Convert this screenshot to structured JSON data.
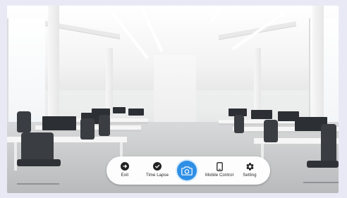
{
  "toolbar": {
    "exit_label": "Exit",
    "time_lapse_label": "Time Lapse",
    "mobile_control_label": "Mobile Control",
    "setting_label": "Setting"
  },
  "icons": {
    "exit": "exit-icon",
    "time_lapse": "time-lapse-icon",
    "capture": "camera-icon",
    "mobile_control": "mobile-icon",
    "setting": "gear-icon"
  },
  "colors": {
    "accent": "#2f8fe6",
    "page_background": "#e9e9f6"
  }
}
